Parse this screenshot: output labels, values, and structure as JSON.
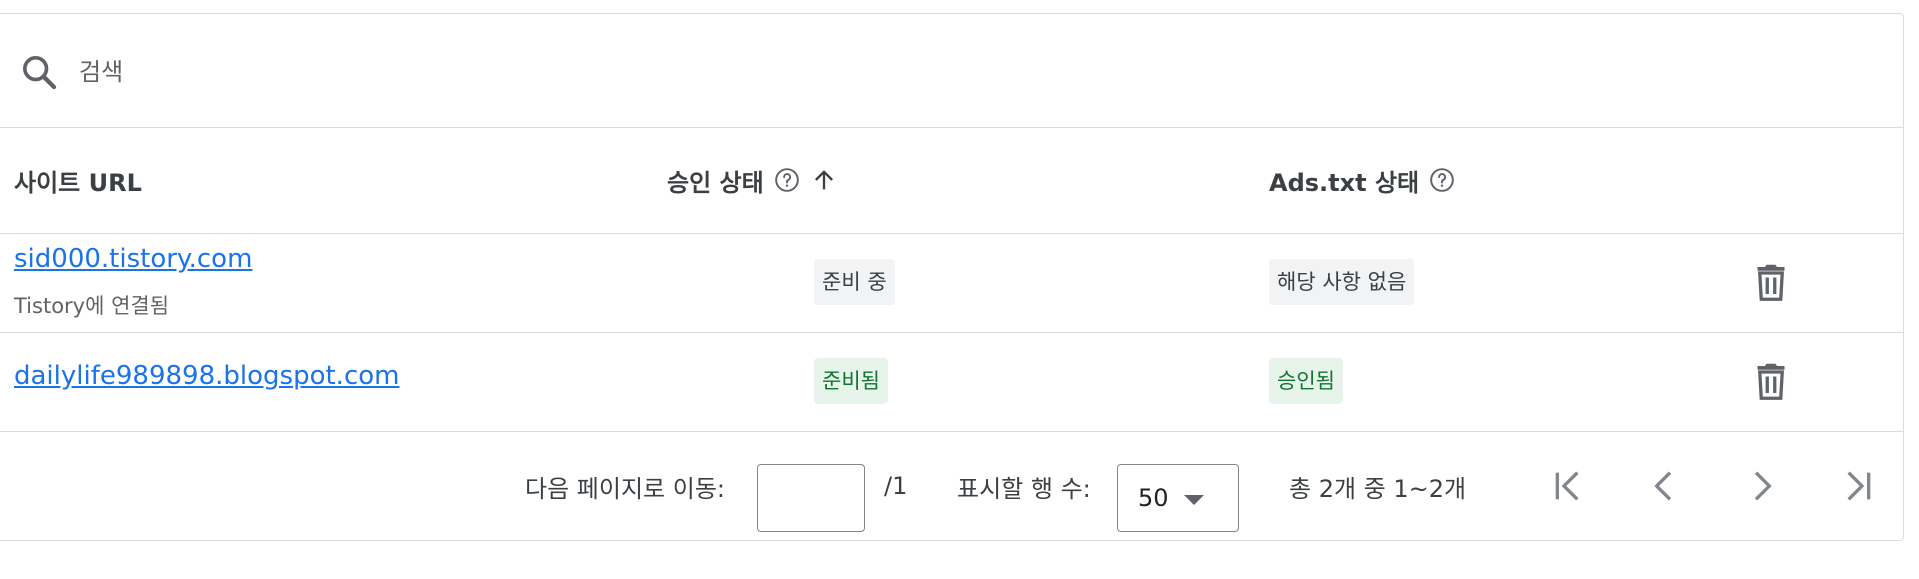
{
  "search": {
    "placeholder": "검색"
  },
  "table": {
    "columns": {
      "site_url": "사이트 URL",
      "approval_status": "승인 상태",
      "ads_txt_status": "Ads.txt 상태"
    },
    "rows": [
      {
        "url": "sid000.tistory.com",
        "sub": "Tistory에 연결됨",
        "approval": "준비 중",
        "ads_txt": "해당 사항 없음"
      },
      {
        "url": "dailylife989898.blogspot.com",
        "sub": "",
        "approval": "준비됨",
        "ads_txt": "승인됨"
      }
    ]
  },
  "pagination": {
    "go_to_page_label": "다음 페이지로 이동:",
    "page_input_value": "",
    "total_pages": "/1",
    "rows_per_page_label": "표시할 행 수:",
    "rows_per_page_value": "50",
    "range_text": "총 2개 중 1~2개"
  },
  "icons": {
    "search": "search-icon",
    "help": "help-circle-icon",
    "sort": "arrow-up-icon",
    "delete": "trash-icon",
    "first": "first-page-icon",
    "prev": "chevron-left-icon",
    "next": "chevron-right-icon",
    "last": "last-page-icon"
  },
  "colors": {
    "link": "#1a73e8",
    "chip_green_bg": "#e6f4ea",
    "chip_green_text": "#137333",
    "chip_gray_bg": "#f1f3f4"
  }
}
